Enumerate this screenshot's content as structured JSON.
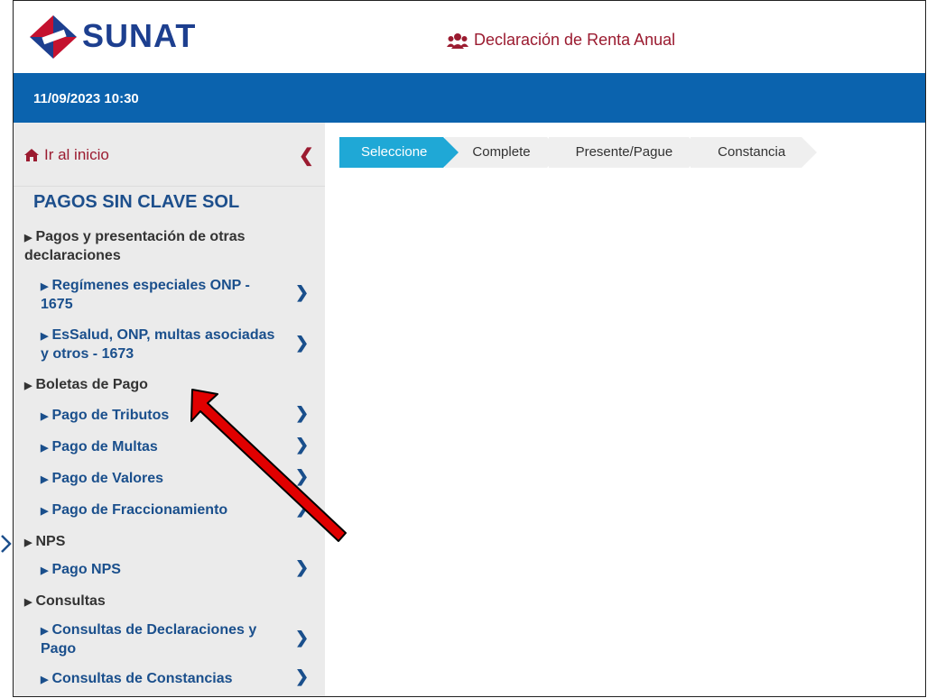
{
  "header": {
    "logo_text": "SUNAT",
    "app_title": "Declaración de Renta Anual",
    "datetime": "11/09/2023 10:30"
  },
  "sidebar": {
    "home_label": "Ir al inicio",
    "section_title": "PAGOS SIN CLAVE SOL",
    "items": [
      {
        "label": "Pagos y presentación de otras declaraciones",
        "level": 1
      },
      {
        "label": "Regímenes especiales ONP - 1675",
        "level": 2
      },
      {
        "label": "EsSalud, ONP, multas asociadas y otros - 1673",
        "level": 2
      },
      {
        "label": "Boletas de Pago",
        "level": 1
      },
      {
        "label": "Pago de Tributos",
        "level": 2
      },
      {
        "label": "Pago de Multas",
        "level": 2
      },
      {
        "label": "Pago de Valores",
        "level": 2
      },
      {
        "label": "Pago de Fraccionamiento",
        "level": 2
      },
      {
        "label": "NPS",
        "level": 1
      },
      {
        "label": "Pago NPS",
        "level": 2
      },
      {
        "label": "Consultas",
        "level": 1
      },
      {
        "label": "Consultas de Declaraciones y Pago",
        "level": 2
      },
      {
        "label": "Consultas de Constancias",
        "level": 2
      }
    ]
  },
  "steps": [
    {
      "label": "Seleccione",
      "active": true
    },
    {
      "label": "Complete",
      "active": false
    },
    {
      "label": "Presente/Pague",
      "active": false
    },
    {
      "label": "Constancia",
      "active": false
    }
  ],
  "colors": {
    "brand_blue": "#0b63ae",
    "accent_red": "#9b1b30",
    "step_active": "#1fa8d6",
    "annotation_arrow": "#e00000"
  },
  "icons": {
    "logo": "sunat-diamond-logo",
    "users": "users-icon",
    "home": "home-icon",
    "collapse": "chevron-left-icon",
    "item_chevron": "chevron-right-icon"
  }
}
